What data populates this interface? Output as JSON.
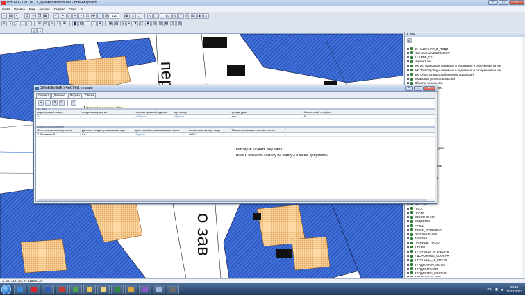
{
  "window": {
    "title": "ИНГЕО - ГИС ИСОГД Раменовского МР - Новый проект",
    "minimize": "–",
    "maximize": "□",
    "close": "✕"
  },
  "menu": [
    "Файл",
    "Правка",
    "Вид",
    "Анализ",
    "Сервис",
    "Окно",
    "?"
  ],
  "toolbar": {
    "zoom_value": "420"
  },
  "dialog": {
    "title": "ЗЕМЕЛЬНЫЕ УЧАСТКИ: термин",
    "tabs": [
      "Объект",
      "Данные",
      "Формы",
      "Связи"
    ],
    "active_tab": "Данные",
    "tooltip": "Настройка порядка таблиц",
    "section1_label": "ЗУ_ДАН",
    "table1": {
      "headers": [
        "кадастровый номер",
        "владельцы участка",
        "форма правообладания",
        "вид номер",
        "улица, дом",
        "Контактный телефон"
      ],
      "row": [
        "1",
        "",
        "<Пусто>",
        "<Пусто>",
        "пер.",
        "8"
      ]
    },
    "section2_label": "Материалы о кадастре",
    "table2": {
      "headers": [
        "Статус земельного участка",
        "Данные о кадастровом инженере",
        "дата составления межевого плана",
        "наименование юр. лица",
        "№ квалификационного аттестата"
      ],
      "row": [
        "1 Временный",
        "Ст.",
        "<Пусто>",
        "ООО \"",
        ""
      ]
    },
    "note_line1": "вот здесь создать еще одно",
    "note_line2": "поле и вставить ссылку на папку а в папке документы"
  },
  "layers_panel": {
    "title": "Слои",
    "items": [
      "10 НАЗВАНИЯ_И_ПОДП",
      "Имя Класса VEGETATION",
      "6 LANDP_CS1",
      "Чертеж1.dwf",
      "500 ИС проводные наземные и подземные и сооружения на них",
      "500 Трубопроводы наземные и подземные и сооружения на них",
      "500 Объекты водоснабжения(не доработан)",
      "носаловой ул.Московская.dwf",
      "Объекты земельного",
      "и сооружения на них",
      "тв.dwf",
      "BOUNDSS",
      "FIELD",
      "ВЕКТОР",
      "ЗУСНИЕ",
      "СИСТЕМЫ",
      "Участки",
      "ОКС",
      "ЗУ",
      "Сооружения",
      "Изолинии",
      "ОКС",
      "КВАРТАЛЫ",
      "Нежилые жилые дома",
      "Жилые дома",
      "Нежилые здания",
      "Здания и жилые",
      "Земельные объекты",
      "Трубопроводы",
      "Гаражи",
      "ОБЪЕКТЫ_СТРО",
      "ЗДАНИЯ",
      "ЗЕМ_УЧАСТКИ",
      "РАЙОНЫ",
      "ОКРУГА",
      "ГРАНИЦЫ",
      "ЦЕНТРЫ",
      "ЛЕСА",
      "ПАРКИ",
      "ОЗЕЛЕНЕНИЕ",
      "ВОДОЕМЫ",
      "РУЧЬИ",
      "ТОЧКИ_ПРИВЯЗКИ",
      "ОБОЗНАЧЕНИЯ",
      "ЗАБОРЫ",
      "ГРАНИЦЫ_НАСЕЛ",
      "7 ТАРЫ",
      "8 ГРАНИЦЫ_И_ЗАБОРЫ",
      "7 ДОРОЖНЫЕ_СООРУЖ",
      "6 ГРАНИЦЫ_И_ОГРАЖ",
      "5 ГИДРОГРАФ_РЕЛЬЕ",
      "4 ГИДРОГРАФИЯ",
      "3 ГИДРОТЕХ_СООРУЖ",
      "2 ЗАПАСНЫЕ_УСЛ",
      "1 НАСЕЛЕННЫЕ_ПУНК",
      "16 НАСЫПИ_ВЫЕМКИ",
      "15 ПЛАН_ВЫС_ОСНОВА",
      "14 МАТЕМАТ_ОСНОВА",
      "11 НАС_ПУНКТЫ_КВАР",
      "16 ПРОМ_И_СОЦ_ОБЪЕ"
    ]
  },
  "statusbar": {
    "coords": "X: 2271151,40; Y: 416364,18"
  },
  "taskbar": {
    "lang": "RU",
    "time": "16:14",
    "date": "12.12.2012"
  }
}
